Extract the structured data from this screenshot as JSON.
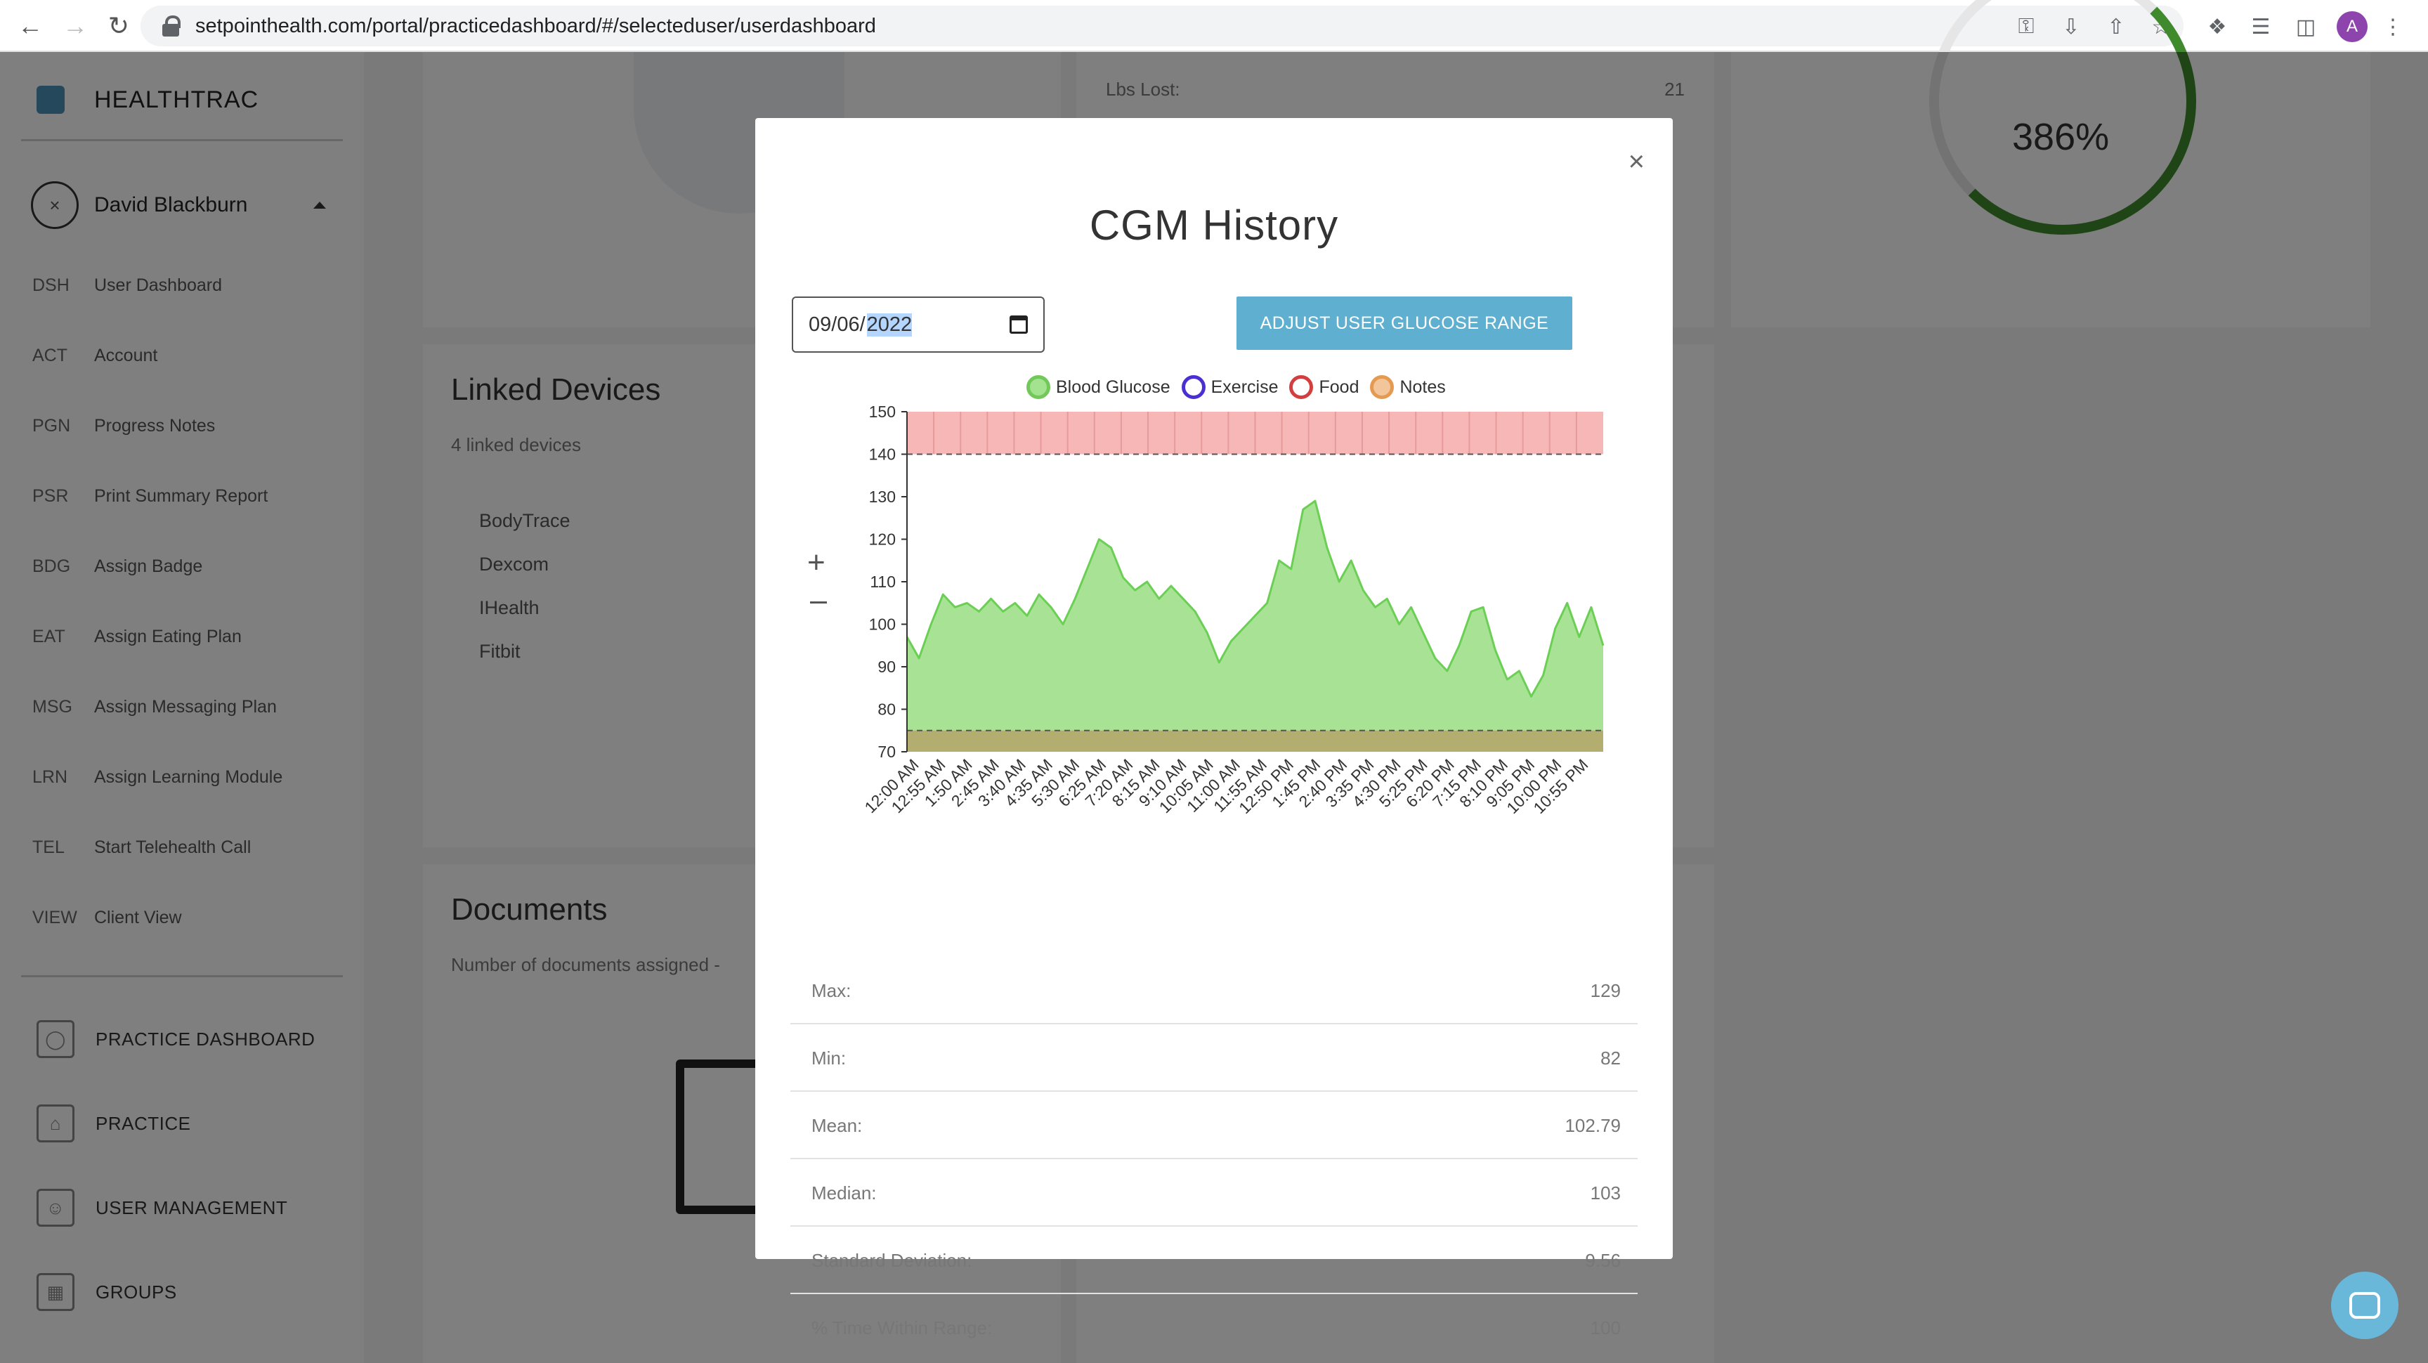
{
  "browser": {
    "url": "setpointhealth.com/portal/practicedashboard/#/selecteduser/userdashboard",
    "profile_initial": "A"
  },
  "sidebar": {
    "brand": "HEALTHTRAC",
    "user_name": "David Blackburn",
    "user_avatar_glyph": "×",
    "items": [
      {
        "abbr": "DSH",
        "label": "User Dashboard"
      },
      {
        "abbr": "ACT",
        "label": "Account"
      },
      {
        "abbr": "PGN",
        "label": "Progress Notes"
      },
      {
        "abbr": "PSR",
        "label": "Print Summary Report"
      },
      {
        "abbr": "BDG",
        "label": "Assign Badge"
      },
      {
        "abbr": "EAT",
        "label": "Assign Eating Plan"
      },
      {
        "abbr": "MSG",
        "label": "Assign Messaging Plan"
      },
      {
        "abbr": "LRN",
        "label": "Assign Learning Module"
      },
      {
        "abbr": "TEL",
        "label": "Start Telehealth Call"
      },
      {
        "abbr": "VIEW",
        "label": "Client View"
      }
    ],
    "sections": [
      {
        "label": "PRACTICE DASHBOARD",
        "icon": "globe-icon"
      },
      {
        "label": "PRACTICE",
        "icon": "bank-icon"
      },
      {
        "label": "USER MANAGEMENT",
        "icon": "id-card-icon"
      },
      {
        "label": "GROUPS",
        "icon": "grid-icon"
      }
    ]
  },
  "dashboard": {
    "lbs_lost_label": "Lbs Lost:",
    "lbs_lost_value": "21",
    "progress_percent_text": "386%",
    "linked_devices": {
      "title": "Linked Devices",
      "subtitle": "4 linked devices",
      "devices": [
        "BodyTrace",
        "Dexcom",
        "IHealth",
        "Fitbit"
      ]
    },
    "documents": {
      "title": "Documents",
      "subtitle": "Number of documents assigned -"
    }
  },
  "modal": {
    "title": "CGM History",
    "close_glyph": "×",
    "date_prefix": "09/06/",
    "date_year": "2022",
    "adjust_button": "ADJUST USER GLUCOSE RANGE",
    "zoom_in_glyph": "+",
    "legend": [
      {
        "label": "Blood Glucose",
        "fill": "#a3e28f",
        "border": "#73c85a"
      },
      {
        "label": "Exercise",
        "fill": "#ffffff",
        "border": "#4b2fd3"
      },
      {
        "label": "Food",
        "fill": "#ffffff",
        "border": "#d33f3f"
      },
      {
        "label": "Notes",
        "fill": "#f2c59a",
        "border": "#e59a52"
      }
    ],
    "stats": [
      {
        "label": "Max:",
        "value": "129"
      },
      {
        "label": "Min:",
        "value": "82"
      },
      {
        "label": "Mean:",
        "value": "102.79"
      },
      {
        "label": "Median:",
        "value": "103"
      },
      {
        "label": "Standard Deviation:",
        "value": "9.56"
      },
      {
        "label": "% Time Within Range:",
        "value": "100"
      }
    ]
  },
  "chart_data": {
    "type": "area",
    "ylim": [
      70,
      150
    ],
    "y_ticks": [
      70,
      80,
      90,
      100,
      110,
      120,
      130,
      140,
      150
    ],
    "x_ticks": [
      "12:00 AM",
      "12:55 AM",
      "1:50 AM",
      "2:45 AM",
      "3:40 AM",
      "4:35 AM",
      "5:30 AM",
      "6:25 AM",
      "7:20 AM",
      "8:15 AM",
      "9:10 AM",
      "10:05 AM",
      "11:00 AM",
      "11:55 AM",
      "12:50 PM",
      "1:45 PM",
      "2:40 PM",
      "3:35 PM",
      "4:30 PM",
      "5:25 PM",
      "6:20 PM",
      "7:15 PM",
      "8:10 PM",
      "9:05 PM",
      "10:00 PM",
      "10:55 PM"
    ],
    "target_range": {
      "low": 75,
      "high": 140
    },
    "bands": [
      {
        "from": 140,
        "to": 150,
        "color": "#f7b7b7"
      },
      {
        "from": 70,
        "to": 75,
        "color": "#b5a86c"
      }
    ],
    "series": [
      {
        "name": "Blood Glucose",
        "color": "#a3e28f",
        "line_color": "#6ccf55",
        "values": [
          97,
          92,
          100,
          107,
          104,
          105,
          103,
          106,
          103,
          105,
          102,
          107,
          104,
          100,
          106,
          113,
          120,
          118,
          111,
          108,
          110,
          106,
          109,
          106,
          103,
          98,
          91,
          96,
          99,
          102,
          105,
          115,
          113,
          127,
          129,
          118,
          110,
          115,
          108,
          104,
          106,
          100,
          104,
          98,
          92,
          89,
          95,
          103,
          104,
          94,
          87,
          89,
          83,
          88,
          99,
          105,
          97,
          104,
          95
        ]
      }
    ]
  }
}
